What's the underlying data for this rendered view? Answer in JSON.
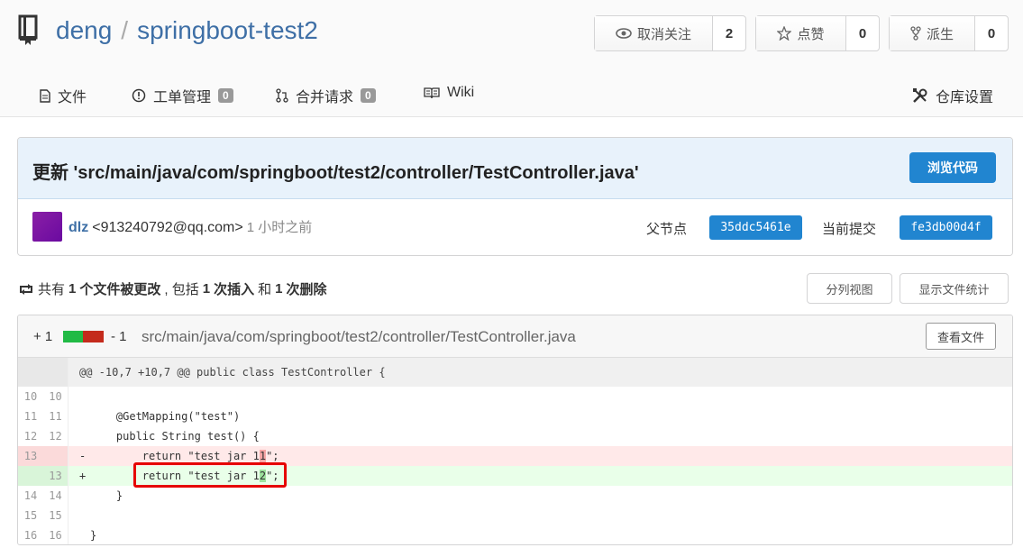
{
  "repo": {
    "owner": "deng",
    "separator": "/",
    "name": "springboot-test2"
  },
  "actions": {
    "watch": {
      "label": "取消关注",
      "count": "2"
    },
    "star": {
      "label": "点赞",
      "count": "0"
    },
    "fork": {
      "label": "派生",
      "count": "0"
    }
  },
  "tabs": {
    "files": {
      "label": "文件"
    },
    "issues": {
      "label": "工单管理",
      "badge": "0"
    },
    "pulls": {
      "label": "合并请求",
      "badge": "0"
    },
    "wiki": {
      "label": "Wiki"
    },
    "settings": {
      "label": "仓库设置"
    }
  },
  "commit": {
    "title": "更新 'src/main/java/com/springboot/test2/controller/TestController.java'",
    "browse_label": "浏览代码",
    "author_name": "dlz",
    "author_email": "<913240792@qq.com>",
    "time": "1 小时之前",
    "parent_label": "父节点",
    "parent_sha": "35ddc5461e",
    "current_label": "当前提交",
    "current_sha": "fe3db00d4f"
  },
  "summary": {
    "prefix": "共有",
    "files": "1",
    "files_text": "个文件被更改",
    "mid": ", 包括",
    "ins": "1",
    "ins_text": "次插入",
    "and": "和",
    "del": "1",
    "del_text": "次删除",
    "split_label": "分列视图",
    "stats_label": "显示文件统计"
  },
  "diff": {
    "additions": "+ 1",
    "deletions": "- 1",
    "path": "src/main/java/com/springboot/test2/controller/TestController.java",
    "view_file_label": "查看文件",
    "hunk": "@@ -10,7 +10,7 @@ public class TestController {",
    "lines": [
      {
        "old": "10",
        "new": "10",
        "sign": "",
        "text": ""
      },
      {
        "old": "11",
        "new": "11",
        "sign": "",
        "text": "    @GetMapping(\"test\")"
      },
      {
        "old": "12",
        "new": "12",
        "sign": "",
        "text": "    public String test() {"
      },
      {
        "old": "13",
        "new": "",
        "sign": "-",
        "text_a": "        return \"test jar 1",
        "text_hl": "1",
        "text_b": "\";"
      },
      {
        "old": "",
        "new": "13",
        "sign": "+",
        "text_a": "        return \"test jar 1",
        "text_hl": "2",
        "text_b": "\";"
      },
      {
        "old": "14",
        "new": "14",
        "sign": "",
        "text": "    }"
      },
      {
        "old": "15",
        "new": "15",
        "sign": "",
        "text": ""
      },
      {
        "old": "16",
        "new": "16",
        "sign": "",
        "text": "}"
      }
    ]
  },
  "colors": {
    "link": "#3e6fa6",
    "primary": "#2185d0",
    "add": "#21ba45",
    "del": "#c42b1c",
    "highlight_box": "#e60000"
  }
}
